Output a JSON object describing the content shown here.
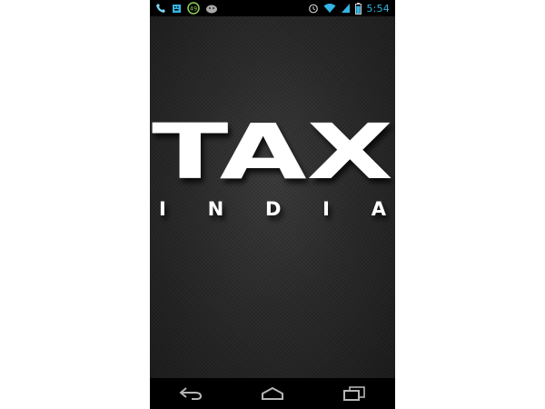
{
  "status_bar": {
    "time": "5:54",
    "battery_percent": 0.85,
    "left_icons": [
      "phone-call-icon",
      "keyboard-icon",
      "badge-49-icon",
      "android-icon"
    ],
    "badge_count": "49",
    "right_icons": [
      "alarm-icon",
      "wifi-icon",
      "signal-icon",
      "battery-icon"
    ],
    "accent_color": "#33b5e5"
  },
  "splash": {
    "title": "TAX",
    "subtitle": "I N D I A",
    "background_color": "#2b2b2b",
    "text_color": "#ffffff"
  },
  "nav_bar": {
    "buttons": [
      "back-button",
      "home-button",
      "recent-apps-button"
    ]
  }
}
